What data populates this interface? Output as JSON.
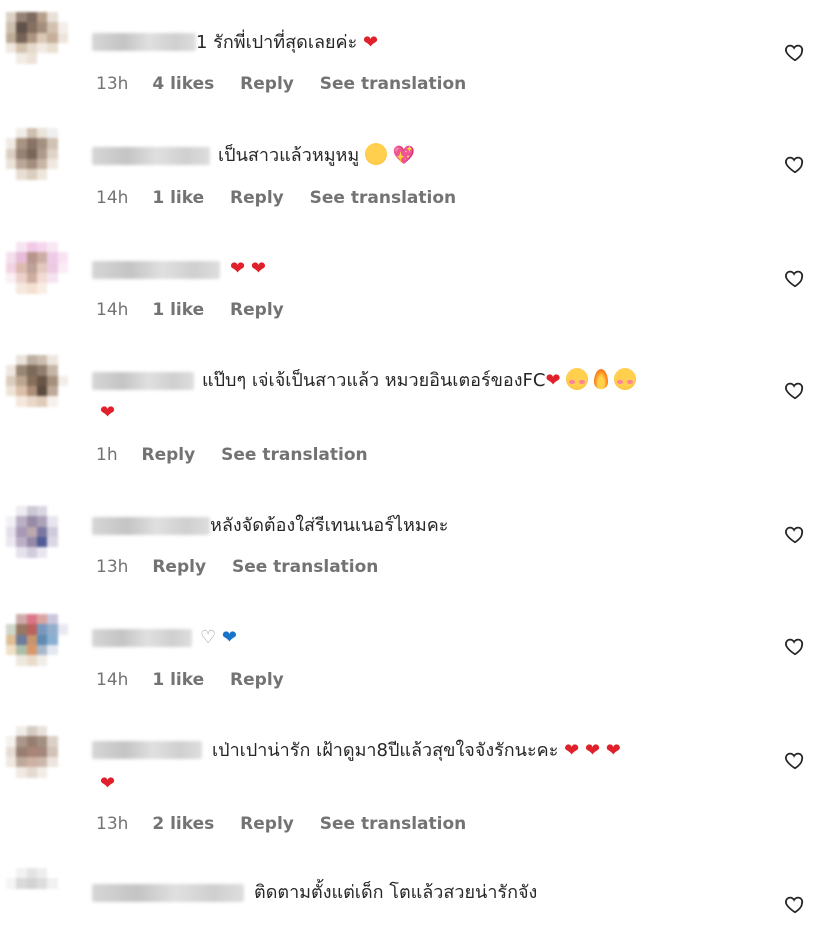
{
  "comments": [
    {
      "text": "1 รักพี่เปาที่สุดเลยค่ะ",
      "time": "13h",
      "likes": "4 likes",
      "reply": "Reply",
      "translation": "See translation"
    },
    {
      "text": "เป็นสาวแล้วหมูหมู",
      "time": "14h",
      "likes": "1 like",
      "reply": "Reply",
      "translation": "See translation"
    },
    {
      "text": "",
      "time": "14h",
      "likes": "1 like",
      "reply": "Reply"
    },
    {
      "text": "แป๊บๆ เจ่เจ้เป็นสาวแล้ว หมวยอินเตอร์ของFC",
      "time": "1h",
      "reply": "Reply",
      "translation": "See translation"
    },
    {
      "text": "หลังจัดต้องใส่รีเทนเนอร์ไหมคะ",
      "time": "13h",
      "reply": "Reply",
      "translation": "See translation"
    },
    {
      "text": "",
      "time": "14h",
      "likes": "1 like",
      "reply": "Reply"
    },
    {
      "text": "เป่าเปาน่ารัก เฝ้าดูมา8ปีแล้วสุขใจจังรักนะคะ",
      "time": "13h",
      "likes": "2 likes",
      "reply": "Reply",
      "translation": "See translation"
    },
    {
      "text": "ติดตามตั้งแต่เด็ก โตแล้วสวยน่ารักจัง"
    }
  ],
  "icons": {
    "heart_outline": "♡",
    "red_heart": "❤",
    "white_heart": "♡",
    "blue_heart": "❤",
    "sparkling_heart": "💖"
  }
}
